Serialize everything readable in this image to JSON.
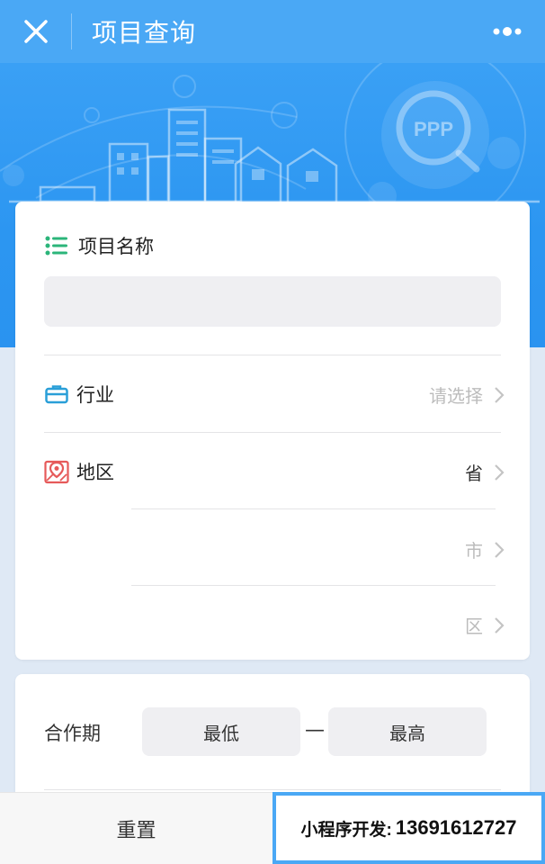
{
  "header": {
    "title": "项目查询",
    "close_icon": "close-icon",
    "more_icon": "more-dots-icon"
  },
  "banner": {
    "badge_text": "PPP"
  },
  "form": {
    "project_name": {
      "label": "项目名称",
      "icon": "list-icon",
      "value": ""
    },
    "industry": {
      "label": "行业",
      "icon": "briefcase-icon",
      "placeholder": "请选择"
    },
    "region": {
      "label": "地区",
      "icon": "map-pin-icon",
      "province": "省",
      "city": "市",
      "district": "区"
    },
    "cooperation_period": {
      "label": "合作期",
      "min": "最低",
      "separator": "—",
      "max": "最高"
    }
  },
  "bottom": {
    "reset_label": "重置",
    "promo_label": "小程序开发:",
    "promo_number": "13691612727"
  },
  "colors": {
    "primary": "#4aa8f5",
    "banner": "#2c96f1",
    "accent_green": "#2bb57a",
    "accent_red": "#e65a5a"
  }
}
